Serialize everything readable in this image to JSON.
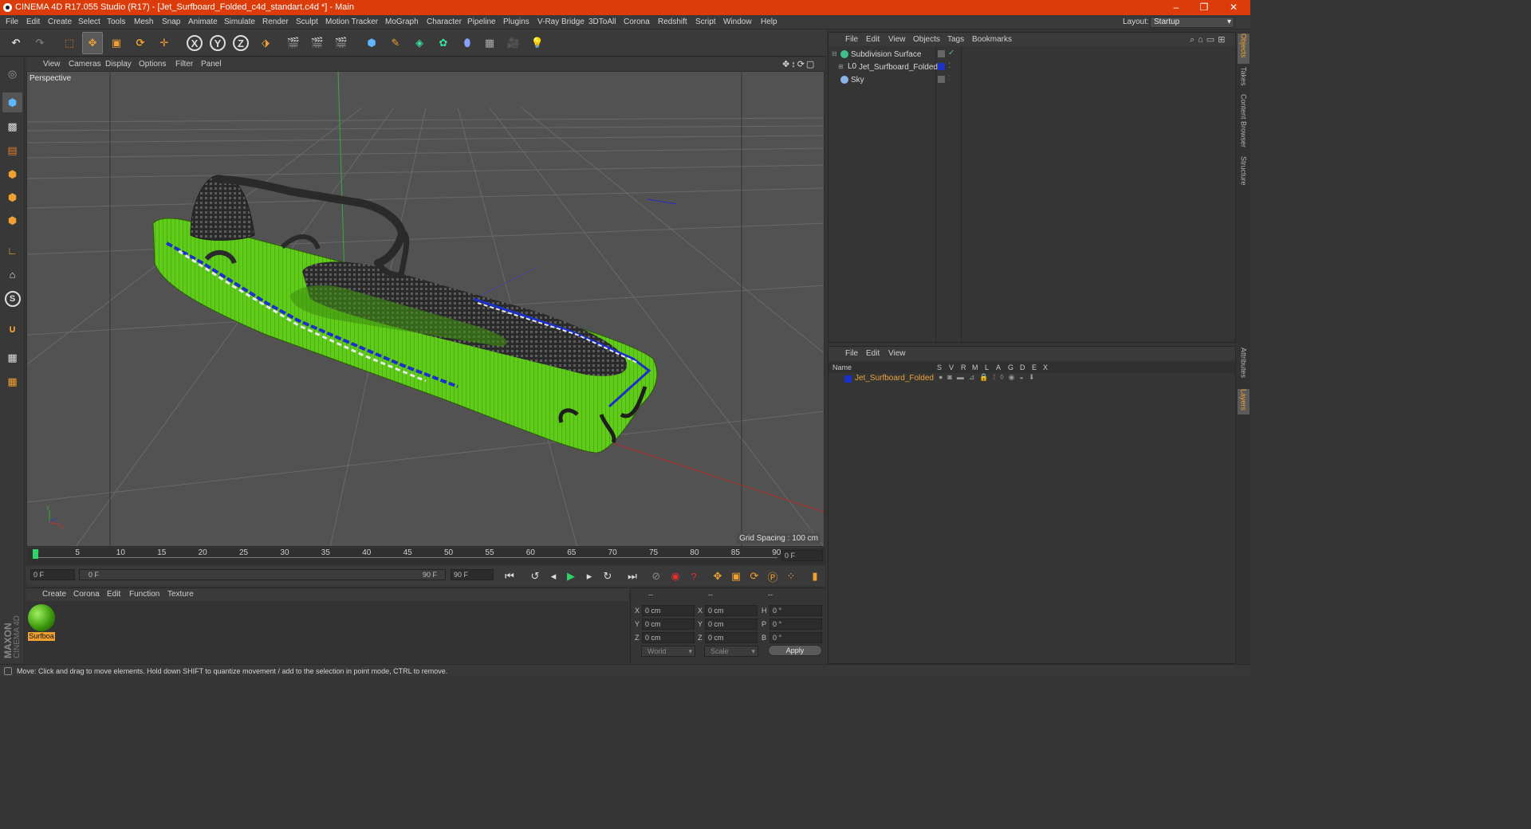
{
  "window": {
    "title": "CINEMA 4D R17.055 Studio (R17) - [Jet_Surfboard_Folded_c4d_standart.c4d *] - Main",
    "controls": [
      "–",
      "❐",
      "✕"
    ]
  },
  "menubar": {
    "items": [
      "File",
      "Edit",
      "Create",
      "Select",
      "Tools",
      "Mesh",
      "Snap",
      "Animate",
      "Simulate",
      "Render",
      "Sculpt",
      "Motion Tracker",
      "MoGraph",
      "Character",
      "Pipeline",
      "Plugins",
      "V-Ray Bridge",
      "3DToAll",
      "Corona",
      "Redshift",
      "Script",
      "Window",
      "Help"
    ],
    "layout_label": "Layout:",
    "layout_value": "Startup"
  },
  "toolbar": {
    "axes": [
      "X",
      "Y",
      "Z"
    ]
  },
  "viewport": {
    "menu": [
      "View",
      "Cameras",
      "Display",
      "Options",
      "Filter",
      "Panel"
    ],
    "label": "Perspective",
    "grid_spacing": "Grid Spacing : 100 cm"
  },
  "timeline": {
    "ticks": [
      "0",
      "5",
      "10",
      "15",
      "20",
      "25",
      "30",
      "35",
      "40",
      "45",
      "50",
      "55",
      "60",
      "65",
      "70",
      "75",
      "80",
      "85",
      "90"
    ],
    "current_frame": "0 F",
    "start_field": "0 F",
    "range_start": "0 F",
    "range_end": "90 F",
    "end_field": "90 F"
  },
  "materials": {
    "menu": [
      "Create",
      "Corona",
      "Edit",
      "Function",
      "Texture"
    ],
    "items": [
      {
        "name": "Surfboa"
      }
    ]
  },
  "coordinates": {
    "headers": [
      "--",
      "--",
      "--"
    ],
    "rows": [
      {
        "a_label": "X",
        "a_val": "0 cm",
        "b_label": "X",
        "b_val": "0 cm",
        "c_label": "H",
        "c_val": "0 °"
      },
      {
        "a_label": "Y",
        "a_val": "0 cm",
        "b_label": "Y",
        "b_val": "0 cm",
        "c_label": "P",
        "c_val": "0 °"
      },
      {
        "a_label": "Z",
        "a_val": "0 cm",
        "b_label": "Z",
        "b_val": "0 cm",
        "c_label": "B",
        "c_val": "0 °"
      }
    ],
    "mode": "World",
    "transform": "Scale",
    "apply": "Apply"
  },
  "objects": {
    "menu": [
      "File",
      "Edit",
      "View",
      "Objects",
      "Tags",
      "Bookmarks"
    ],
    "items": [
      {
        "name": "Subdivision Surface"
      },
      {
        "name": "Jet_Surfboard_Folded"
      },
      {
        "name": "Sky"
      }
    ]
  },
  "layers": {
    "menu": [
      "File",
      "Edit",
      "View"
    ],
    "columns": [
      "Name",
      "S",
      "V",
      "R",
      "M",
      "L",
      "A",
      "G",
      "D",
      "E",
      "X"
    ],
    "items": [
      {
        "name": "Jet_Surfboard_Folded"
      }
    ]
  },
  "side_tabs": [
    "Objects",
    "Takes",
    "Content Browser",
    "Structure",
    "Attributes",
    "Layers"
  ],
  "status": "Move: Click and drag to move elements. Hold down SHIFT to quantize movement / add to the selection in point mode, CTRL to remove.",
  "brand": {
    "maxon": "MAXON",
    "c4d": "CINEMA 4D"
  },
  "colors": {
    "accent": "#db3c0a",
    "board_green": "#5fcc1a",
    "layer_blue": "#1c2fc9",
    "layer_text": "#e8a23a"
  }
}
